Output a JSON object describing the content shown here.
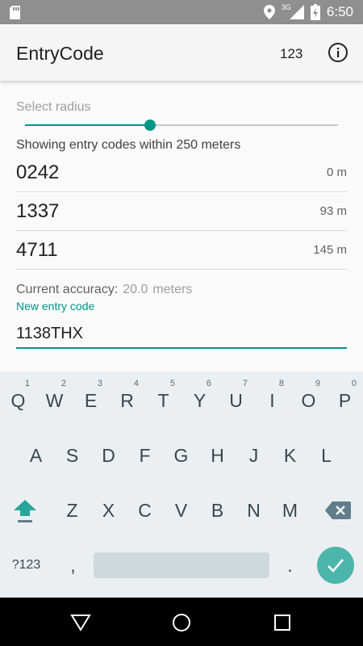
{
  "status_bar": {
    "network": "3G",
    "time": "6:50"
  },
  "app_bar": {
    "title": "EntryCode",
    "action_label": "123",
    "info_icon": "info-icon"
  },
  "radius": {
    "label": "Select radius",
    "slider_fraction": 0.4
  },
  "summary": "Showing entry codes within 250 meters",
  "codes": [
    {
      "code": "0242",
      "distance": "0 m"
    },
    {
      "code": "1337",
      "distance": "93 m"
    },
    {
      "code": "4711",
      "distance": "145 m"
    }
  ],
  "accuracy": {
    "label": "Current accuracy:",
    "value": "20.0",
    "unit": "meters"
  },
  "new_entry": {
    "label": "New entry code",
    "value": "1138THX"
  },
  "keyboard": {
    "row1": [
      {
        "k": "Q",
        "h": "1"
      },
      {
        "k": "W",
        "h": "2"
      },
      {
        "k": "E",
        "h": "3"
      },
      {
        "k": "R",
        "h": "4"
      },
      {
        "k": "T",
        "h": "5"
      },
      {
        "k": "Y",
        "h": "6"
      },
      {
        "k": "U",
        "h": "7"
      },
      {
        "k": "I",
        "h": "8"
      },
      {
        "k": "O",
        "h": "9"
      },
      {
        "k": "P",
        "h": "0"
      }
    ],
    "row2": [
      "A",
      "S",
      "D",
      "F",
      "G",
      "H",
      "J",
      "K",
      "L"
    ],
    "row3": [
      "Z",
      "X",
      "C",
      "V",
      "B",
      "N",
      "M"
    ],
    "symbols_label": "?123",
    "comma": ",",
    "period": "."
  },
  "colors": {
    "accent": "#009688",
    "enter_key": "#4db6ac",
    "status_bar": "#8f8f8f",
    "keyboard_bg": "#eceff1"
  }
}
